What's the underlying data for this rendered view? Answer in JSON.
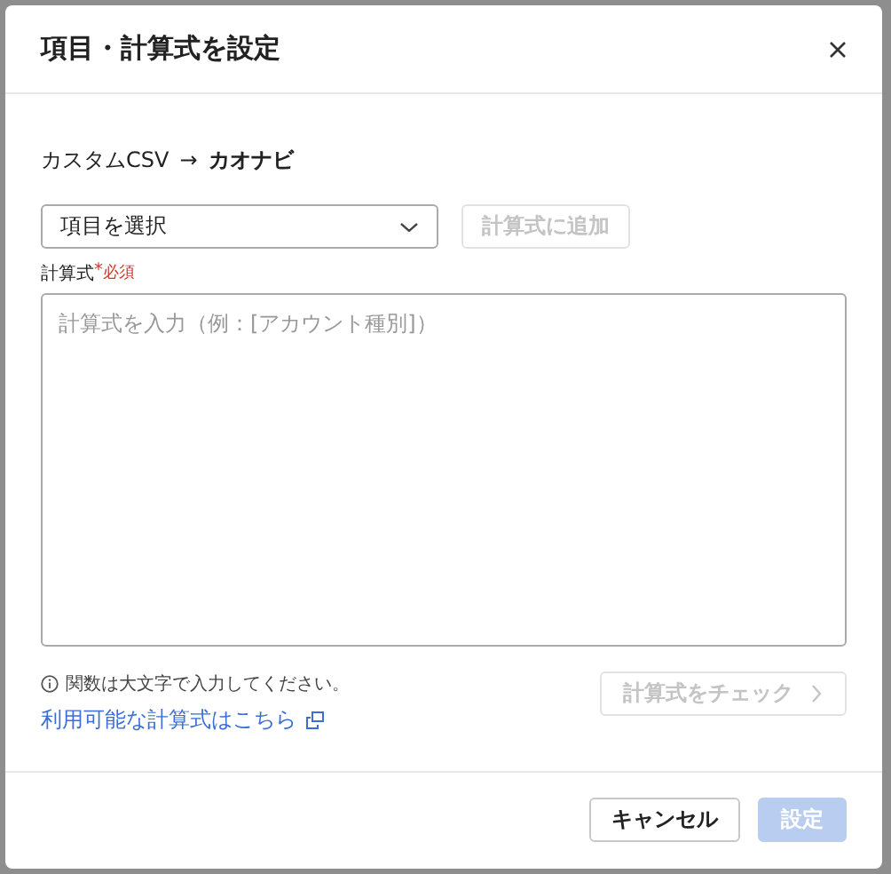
{
  "dialog": {
    "title": "項目・計算式を設定",
    "mapping": {
      "source": "カスタムCSV",
      "arrow": "→",
      "target": "カオナビ"
    },
    "item_select": {
      "value": "項目を選択"
    },
    "add_button": {
      "label": "計算式に追加",
      "disabled": true
    },
    "formula": {
      "label": "計算式",
      "required_mark": "*",
      "required_text": "必須",
      "placeholder": "計算式を入力（例：[アカウント種別]）"
    },
    "hint": "関数は大文字で入力してください。",
    "link": "利用可能な計算式はこちら",
    "check_button": {
      "label": "計算式をチェック",
      "disabled": true
    },
    "buttons": [
      {
        "label": "キャンセル",
        "kind": "secondary",
        "disabled": false
      },
      {
        "label": "設定",
        "kind": "primary",
        "disabled": true
      }
    ]
  }
}
